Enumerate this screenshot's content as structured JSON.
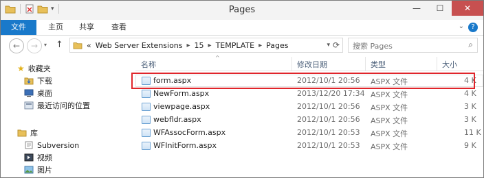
{
  "window": {
    "title": "Pages"
  },
  "ribbon": {
    "tabs": [
      "文件",
      "主页",
      "共享",
      "查看"
    ]
  },
  "address": {
    "crumbs": [
      "Web Server Extensions",
      "15",
      "TEMPLATE",
      "Pages"
    ],
    "overflow": "«"
  },
  "search": {
    "placeholder": "搜索 Pages"
  },
  "nav": {
    "favorites": {
      "label": "收藏夹",
      "items": [
        "下载",
        "桌面",
        "最近访问的位置"
      ]
    },
    "libraries": {
      "label": "库",
      "items": [
        "Subversion",
        "视频",
        "图片"
      ]
    }
  },
  "columns": {
    "name": "名称",
    "date": "修改日期",
    "type": "类型",
    "size": "大小"
  },
  "files": [
    {
      "name": "form.aspx",
      "date": "2012/10/1 20:56",
      "type": "ASPX 文件",
      "size": "4 K"
    },
    {
      "name": "NewForm.aspx",
      "date": "2013/12/20 17:34",
      "type": "ASPX 文件",
      "size": "4 K"
    },
    {
      "name": "viewpage.aspx",
      "date": "2012/10/1 20:56",
      "type": "ASPX 文件",
      "size": "3 K"
    },
    {
      "name": "webfldr.aspx",
      "date": "2012/10/1 20:56",
      "type": "ASPX 文件",
      "size": "3 K"
    },
    {
      "name": "WFAssocForm.aspx",
      "date": "2012/10/1 20:53",
      "type": "ASPX 文件",
      "size": "11 K"
    },
    {
      "name": "WFInitForm.aspx",
      "date": "2012/10/1 20:53",
      "type": "ASPX 文件",
      "size": "9 K"
    }
  ],
  "colors": {
    "accent": "#1979ca",
    "highlight": "#e0252b",
    "close": "#c75050"
  }
}
